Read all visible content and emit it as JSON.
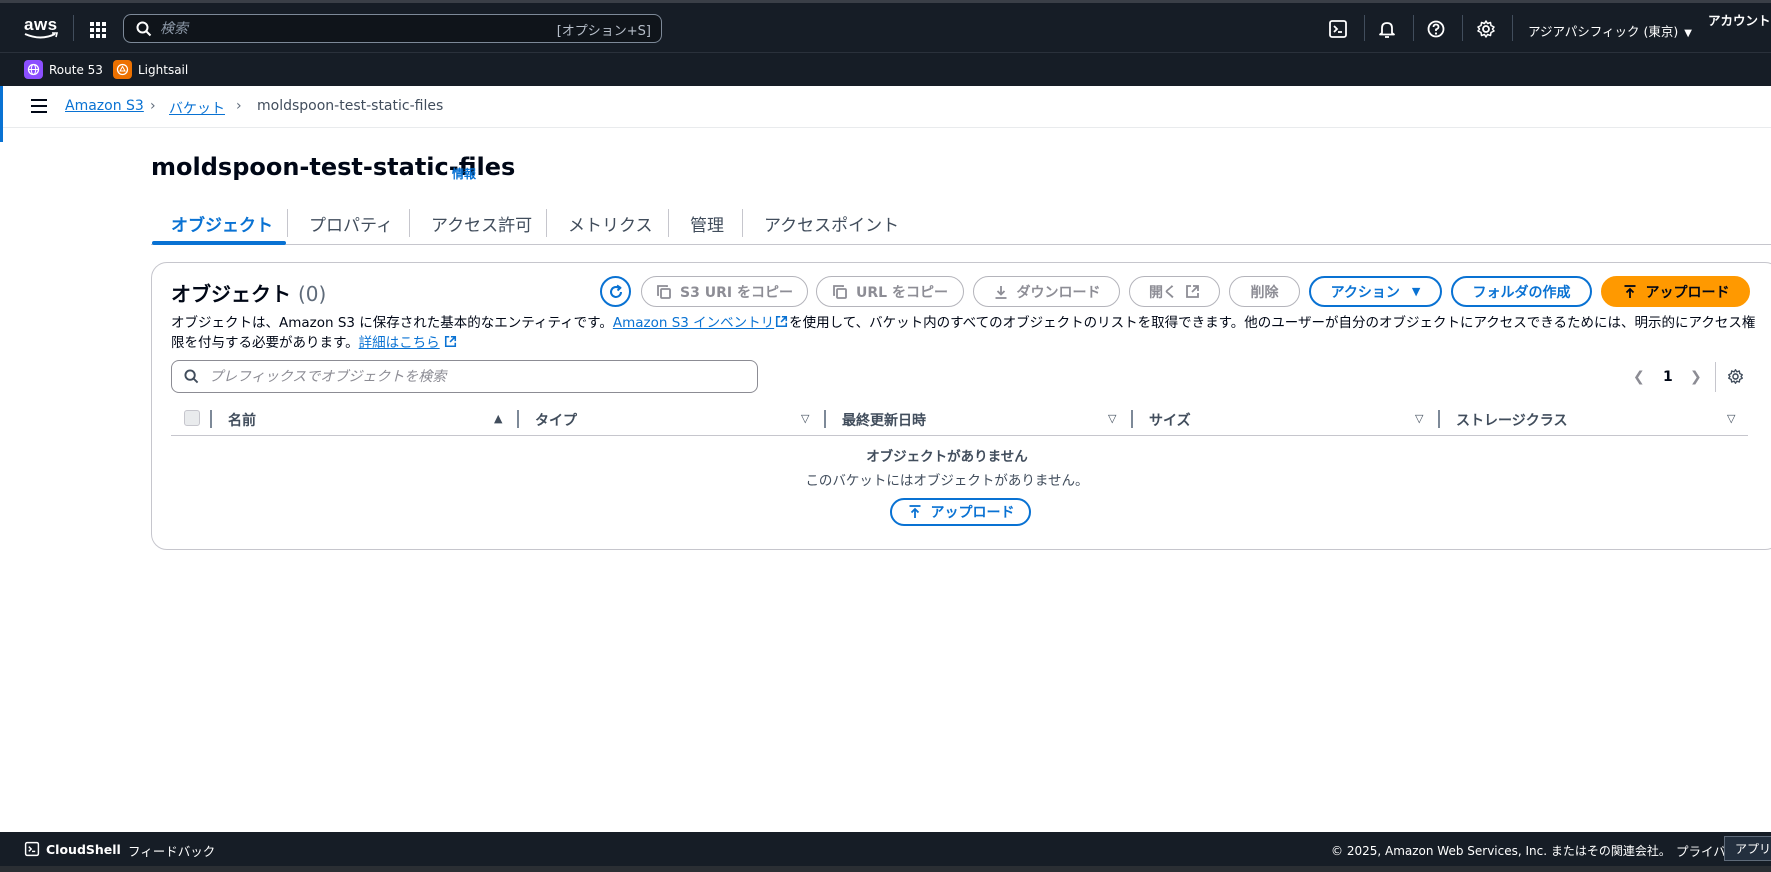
{
  "topbar": {
    "logo_text": "aws",
    "search_placeholder": "検索",
    "search_shortcut": "[オプション+S]",
    "region": "アジアパシフィック (東京)",
    "account": "アカウント",
    "icons": [
      "cloudshell-icon",
      "bell-icon",
      "help-icon",
      "gear-icon"
    ]
  },
  "favorites": [
    {
      "label": "Route 53",
      "color": "#8c4fff"
    },
    {
      "label": "Lightsail",
      "color": "#ed7100"
    }
  ],
  "breadcrumb": {
    "items": [
      "Amazon S3",
      "バケット",
      "moldspoon-test-static-files"
    ]
  },
  "page": {
    "title": "moldspoon-test-static-files",
    "info": "情報"
  },
  "tabs": [
    "オブジェクト",
    "プロパティ",
    "アクセス許可",
    "メトリクス",
    "管理",
    "アクセスポイント"
  ],
  "objects": {
    "title": "オブジェクト",
    "count": "(0)",
    "buttons": {
      "copy_s3_uri": "S3 URI をコピー",
      "copy_url": "URL をコピー",
      "download": "ダウンロード",
      "open": "開く",
      "delete": "削除",
      "actions": "アクション",
      "create_folder": "フォルダの作成",
      "upload": "アップロード"
    },
    "desc_part1": "オブジェクトは、Amazon S3 に保存された基本的なエンティティです。",
    "desc_link1": "Amazon S3 インベントリ",
    "desc_part2": "を使用して、バケット内のすべてのオブジェクトのリストを取得できます。他のユーザーが自分のオブジェクトにアクセスできるためには、明示的にアクセス権限を付与する必要があります。",
    "desc_link2": "詳細はこちら",
    "filter_placeholder": "プレフィックスでオブジェクトを検索",
    "page_number": "1",
    "columns": [
      "名前",
      "タイプ",
      "最終更新日時",
      "サイズ",
      "ストレージクラス"
    ],
    "empty_title": "オブジェクトがありません",
    "empty_subtitle": "このバケットにはオブジェクトがありません。",
    "empty_upload": "アップロード"
  },
  "footer": {
    "cloudshell": "CloudShell",
    "feedback": "フィードバック",
    "copyright": "© 2025, Amazon Web Services, Inc. またはその関連会社。",
    "privacy": "プライバシー",
    "app": "アプリ"
  },
  "colors": {
    "nav_bg": "#161d26",
    "link": "#0972d3",
    "primary_button": "#ff9900"
  }
}
